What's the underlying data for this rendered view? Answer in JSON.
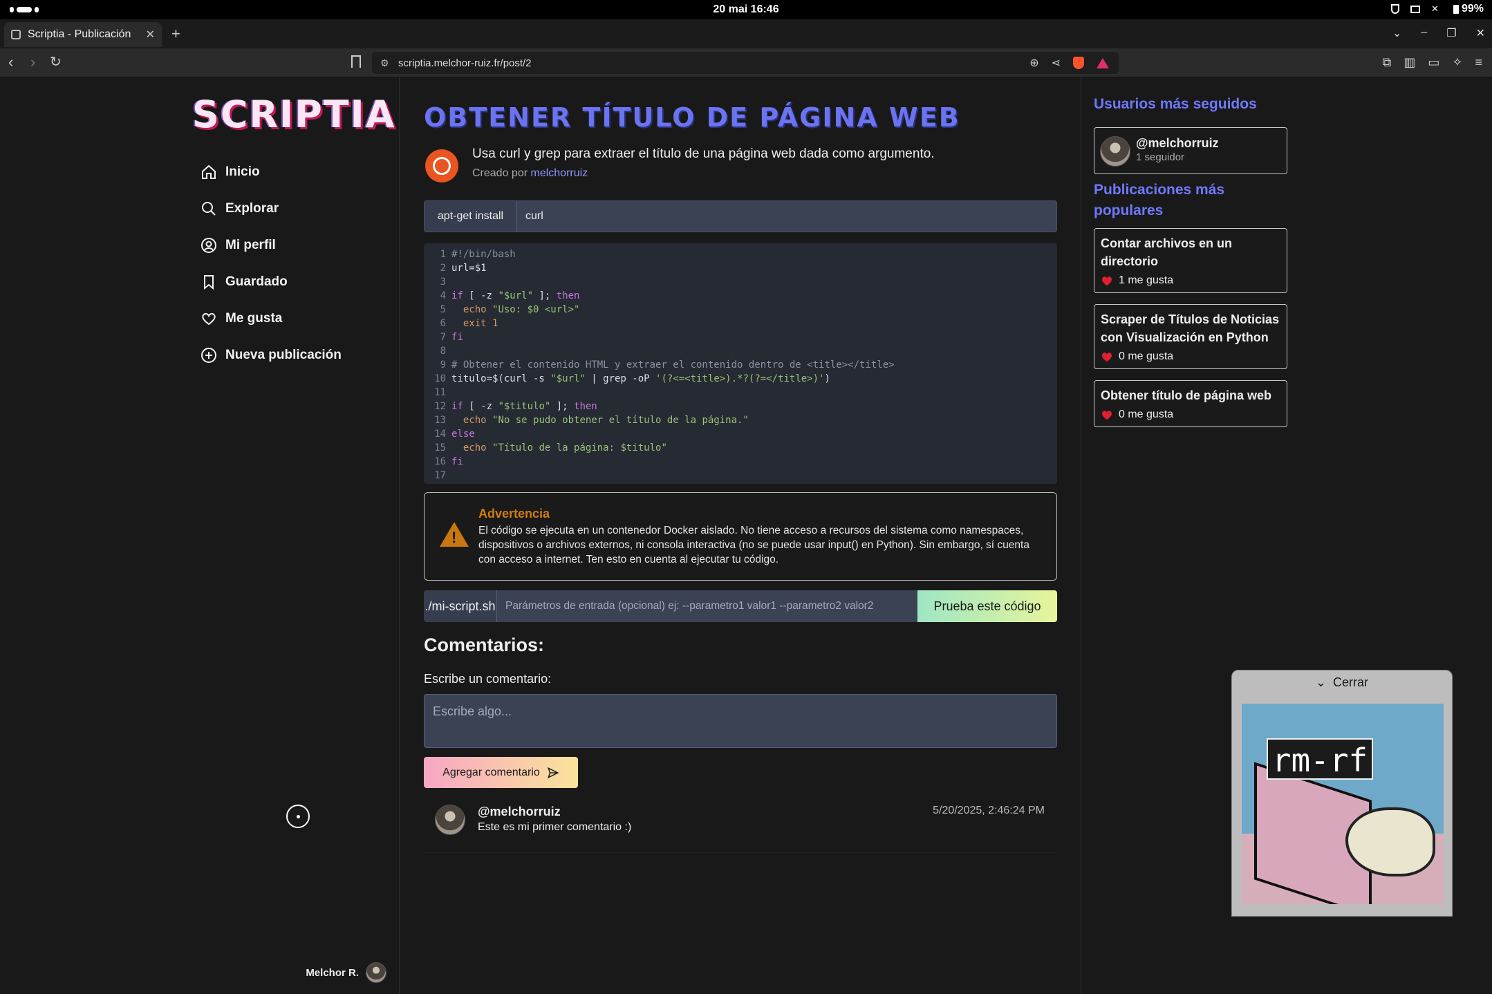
{
  "os": {
    "time": "20 mai  16:46",
    "battery": "99%"
  },
  "browser": {
    "tab_title": "Scriptia - Publicación",
    "url": "scriptia.melchor-ruiz.fr/post/2"
  },
  "sidebar": {
    "logo": "SCRIPTIA",
    "items": [
      {
        "label": "Inicio",
        "icon": "home-icon"
      },
      {
        "label": "Explorar",
        "icon": "search-icon"
      },
      {
        "label": "Mi perfil",
        "icon": "user-circle-icon"
      },
      {
        "label": "Guardado",
        "icon": "bookmark-icon"
      },
      {
        "label": "Me gusta",
        "icon": "heart-icon"
      },
      {
        "label": "Nueva publicación",
        "icon": "plus-circle-icon"
      }
    ],
    "profile_name": "Melchor R."
  },
  "post": {
    "title": "OBTENER TÍTULO DE PÁGINA WEB",
    "description": "Usa curl y grep para extraer el título de una página web dada como argumento.",
    "created_by_prefix": "Creado por",
    "author": "melchorruiz",
    "install_label": "apt-get install",
    "install_packages": "curl",
    "code_lines": [
      "#!/bin/bash",
      "url=$1",
      "",
      "if [ -z \"$url\" ]; then",
      "  echo \"Uso: $0 <url>\"",
      "  exit 1",
      "fi",
      "",
      "# Obtener el contenido HTML y extraer el contenido dentro de <title></title>",
      "titulo=$(curl -s \"$url\" | grep -oP '(?<=<title>).*?(?=</title>)')",
      "",
      "if [ -z \"$titulo\" ]; then",
      "  echo \"No se pudo obtener el título de la página.\"",
      "else",
      "  echo \"Título de la página: $titulo\"",
      "fi",
      ""
    ],
    "warning_title": "Advertencia",
    "warning_text": "El código se ejecuta en un contenedor Docker aislado. No tiene acceso a recursos del sistema como namespaces, dispositivos o archivos externos, ni consola interactiva (no se puede usar input() en Python). Sin embargo, sí cuenta con acceso a internet. Ten esto en cuenta al ejecutar tu código.",
    "run_label": "./mi-script.sh",
    "run_placeholder": "Parámetros de entrada (opcional) ej: --parametro1 valor1 --parametro2 valor2",
    "run_button": "Prueba este código"
  },
  "comments": {
    "heading": "Comentarios:",
    "write_label": "Escribe un comentario:",
    "placeholder": "Escribe algo...",
    "add_button": "Agregar comentario",
    "items": [
      {
        "user": "@melchorruiz",
        "text": "Este es mi primer comentario :)",
        "date": "5/20/2025, 2:46:24 PM"
      }
    ]
  },
  "right": {
    "followed_heading": "Usuarios más seguidos",
    "followed": [
      {
        "user": "@melchorruiz",
        "followers": "1 seguidor"
      }
    ],
    "popular_heading": "Publicaciones más populares",
    "popular": [
      {
        "title": "Contar archivos en un directorio",
        "likes": "1 me gusta"
      },
      {
        "title": "Scraper de Títulos de Noticias con Visualización en Python",
        "likes": "0 me gusta"
      },
      {
        "title": "Obtener título de página web",
        "likes": "0 me gusta"
      }
    ]
  },
  "widget": {
    "close_label": "Cerrar",
    "image_text": "rm-rf"
  },
  "colors": {
    "accent": "#6b74f0",
    "warning": "#d07c12",
    "heart": "#e0202f",
    "ubuntu": "#e95420"
  }
}
